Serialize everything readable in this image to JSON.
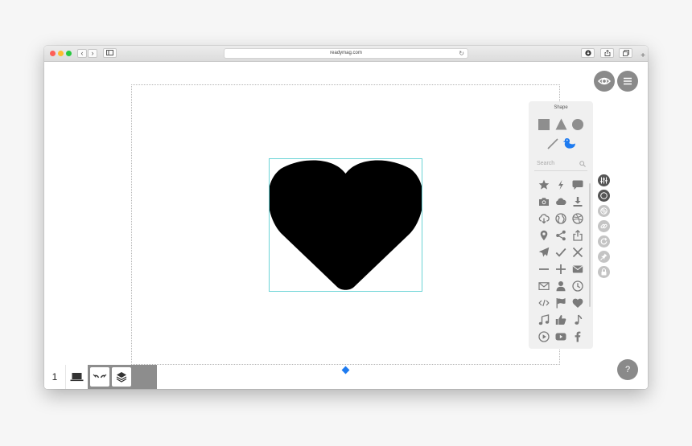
{
  "browser": {
    "url": "readymag.com",
    "back_glyph": "‹",
    "forward_glyph": "›",
    "reload_glyph": "↻",
    "new_tab_glyph": "+"
  },
  "toolbar": {
    "preview_icon": "eye-icon",
    "menu_icon": "hamburger-menu-icon"
  },
  "canvas": {
    "selected_shape": "heart",
    "shape_color": "#000000",
    "selection_color": "#6ad3d6",
    "handle_color": "#1e7bf0"
  },
  "shape_panel": {
    "title": "Shape",
    "search_placeholder": "Search",
    "basic_shapes": [
      "square-icon",
      "triangle-icon",
      "circle-icon",
      "line-icon",
      "duck-icon"
    ],
    "active_shape": "duck-icon",
    "active_color": "#1e7bf0",
    "icon_color": "#7a7a7a",
    "icons": [
      [
        "star-icon",
        "lightning-icon",
        "speech-bubble-icon"
      ],
      [
        "camera-icon",
        "cloud-icon",
        "download-icon"
      ],
      [
        "cloud-download-icon",
        "globe-icon",
        "dribbble-icon"
      ],
      [
        "map-pin-icon",
        "share-icon",
        "upload-icon"
      ],
      [
        "paper-plane-icon",
        "check-icon",
        "close-icon"
      ],
      [
        "minus-icon",
        "plus-icon",
        "mail-filled-icon"
      ],
      [
        "mail-outline-icon",
        "user-icon",
        "clock-icon"
      ],
      [
        "code-icon",
        "flag-icon",
        "heart-icon"
      ],
      [
        "music-note-double-icon",
        "thumbs-up-icon",
        "music-note-icon"
      ],
      [
        "play-icon",
        "youtube-icon",
        "facebook-icon"
      ]
    ]
  },
  "side_rail": [
    "settings-sliders-icon",
    "fill-icon",
    "stroke-icon",
    "link-icon",
    "rotate-icon",
    "pin-icon",
    "lock-icon"
  ],
  "bottom_bar": {
    "page_number": "1",
    "add_label": "+"
  },
  "help": {
    "label": "?"
  }
}
